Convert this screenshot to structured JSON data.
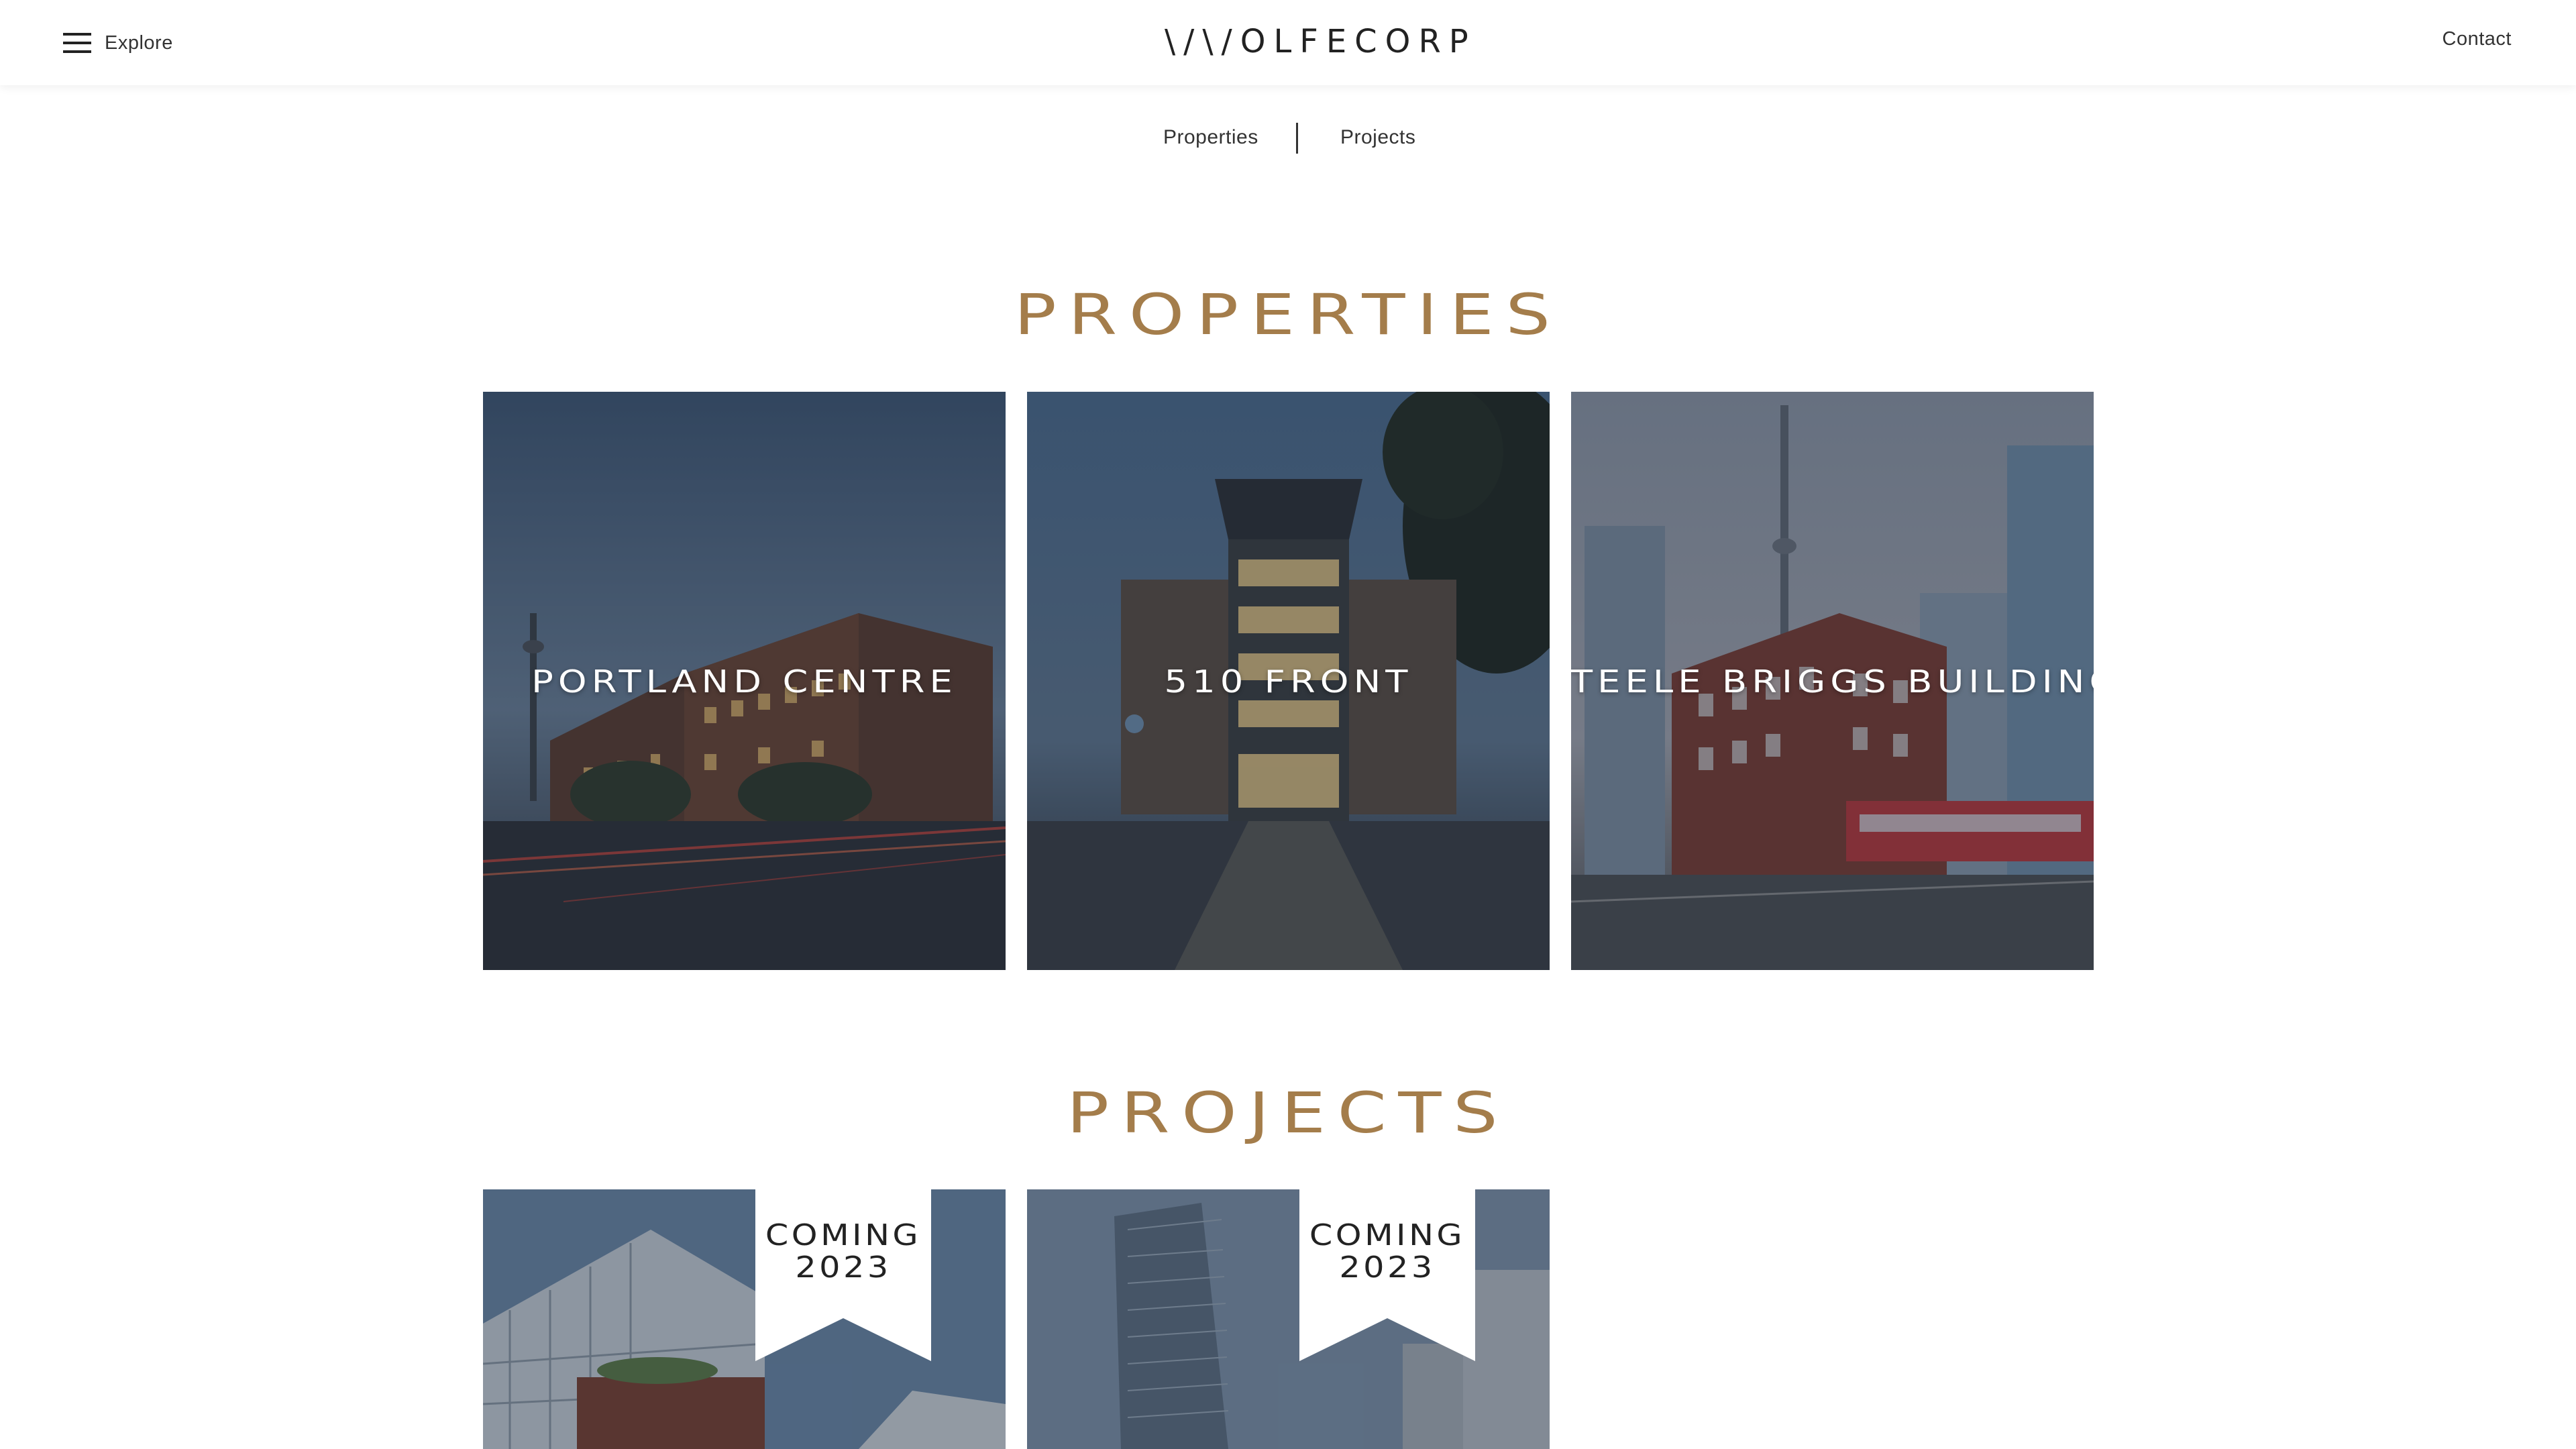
{
  "header": {
    "menu_label": "Explore",
    "logo_text": "\\/\\/OLFECORP",
    "contact_label": "Contact"
  },
  "subnav": {
    "properties_label": "Properties",
    "projects_label": "Projects"
  },
  "sections": {
    "properties_title": "PROPERTIES",
    "projects_title": "PROJECTS"
  },
  "properties": [
    {
      "name": "PORTLAND CENTRE"
    },
    {
      "name": "510 FRONT"
    },
    {
      "name": "STEELE BRIGGS BUILDING"
    }
  ],
  "projects": [
    {
      "badge_line1": "COMING",
      "badge_line2": "2023"
    },
    {
      "badge_line1": "COMING",
      "badge_line2": "2023"
    }
  ],
  "colors": {
    "accent": "#a47d4b",
    "text": "#222222",
    "background": "#ffffff"
  }
}
